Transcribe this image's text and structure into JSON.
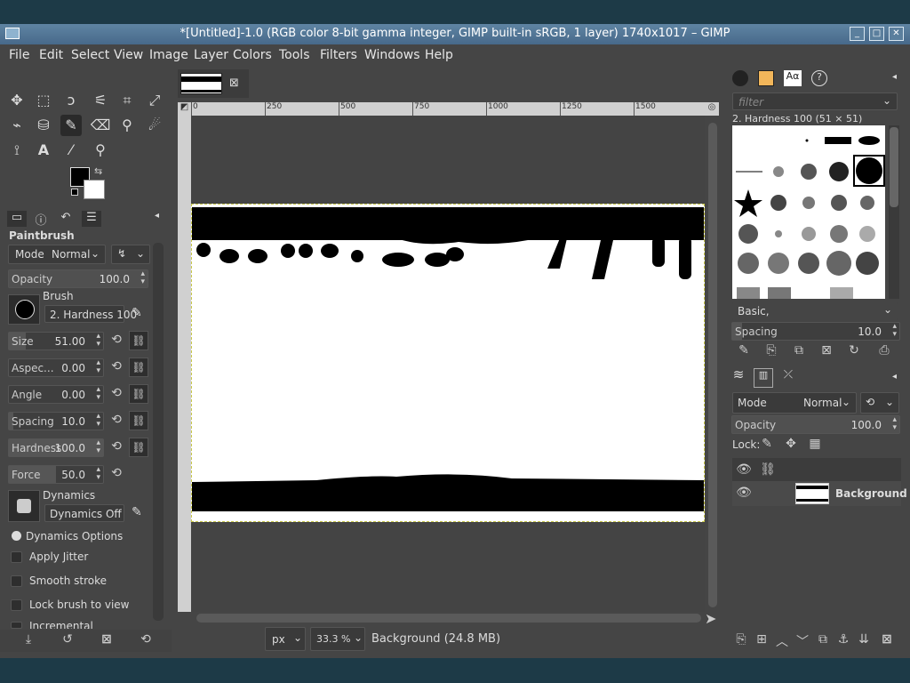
{
  "window": {
    "title": "*[Untitled]-1.0 (RGB color 8-bit gamma integer, GIMP built-in sRGB, 1 layer) 1740x1017 – GIMP"
  },
  "menubar": [
    "File",
    "Edit",
    "Select",
    "View",
    "Image",
    "Layer",
    "Colors",
    "Tools",
    "Filters",
    "Windows",
    "Help"
  ],
  "tool_options": {
    "title": "Paintbrush",
    "mode_label": "Mode",
    "mode_value": "Normal",
    "opacity_label": "Opacity",
    "opacity_value": "100.0",
    "brush_label": "Brush",
    "brush_name": "2. Hardness 100",
    "sliders": [
      {
        "name": "Size",
        "value": "51.00"
      },
      {
        "name": "Aspec...",
        "value": "0.00"
      },
      {
        "name": "Angle",
        "value": "0.00"
      },
      {
        "name": "Spacing",
        "value": "10.0"
      },
      {
        "name": "Hardness",
        "value": "100.0"
      },
      {
        "name": "Force",
        "value": "50.0"
      }
    ],
    "dynamics_label": "Dynamics",
    "dynamics_value": "Dynamics Off",
    "dynamics_options": "Dynamics Options",
    "apply_jitter": "Apply Jitter",
    "smooth_stroke": "Smooth stroke",
    "lock_brush": "Lock brush to view",
    "incremental": "Incremental"
  },
  "ruler": {
    "ticks": [
      "0",
      "250",
      "500",
      "750",
      "1000",
      "1250",
      "1500"
    ]
  },
  "status": {
    "unit": "px",
    "zoom": "33.3 %",
    "info": "Background (24.8 MB)"
  },
  "brushes_panel": {
    "filter_placeholder": "filter",
    "brush_title": "2. Hardness 100 (51 × 51)",
    "preset": "Basic,",
    "spacing_label": "Spacing",
    "spacing_value": "10.0"
  },
  "layers_panel": {
    "mode_label": "Mode",
    "mode_value": "Normal",
    "opacity_label": "Opacity",
    "opacity_value": "100.0",
    "lock_label": "Lock:",
    "layer_name": "Background"
  }
}
